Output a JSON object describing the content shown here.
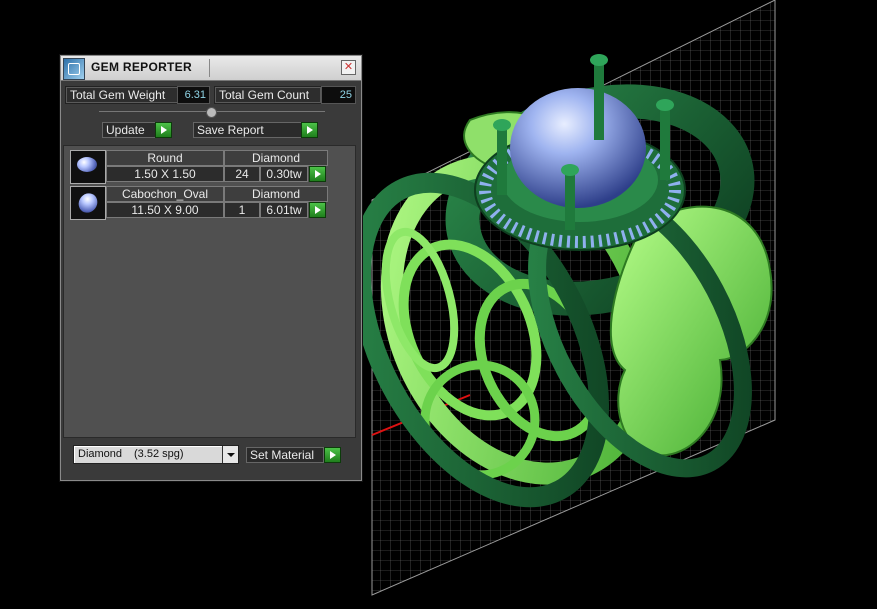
{
  "window": {
    "title": "GEM REPORTER",
    "close_glyph": "✕"
  },
  "stats": {
    "weight_label": "Total Gem Weight",
    "weight_value": "6.31",
    "count_label": "Total Gem Count",
    "count_value": "25"
  },
  "actions": {
    "update_label": "Update",
    "save_report_label": "Save Report"
  },
  "gems": [
    {
      "cut": "Round",
      "material": "Diamond",
      "size": "1.50 X 1.50",
      "count": "24",
      "weight": "0.30tw",
      "thumb_icon": "round-gem-icon"
    },
    {
      "cut": "Cabochon_Oval",
      "material": "Diamond",
      "size": "11.50 X 9.00",
      "count": "1",
      "weight": "6.01tw",
      "thumb_icon": "oval-gem-icon"
    }
  ],
  "material_select": {
    "selected_name": "Diamond",
    "selected_spg": "(3.52 spg)"
  },
  "set_material_label": "Set Material",
  "colors": {
    "ring_green": "#2fbf57",
    "band_dark_green": "#1f7a3c",
    "stone_blue": "#6f8fd9",
    "grid_gray": "#8a8a8a",
    "axis_red": "#d11"
  }
}
